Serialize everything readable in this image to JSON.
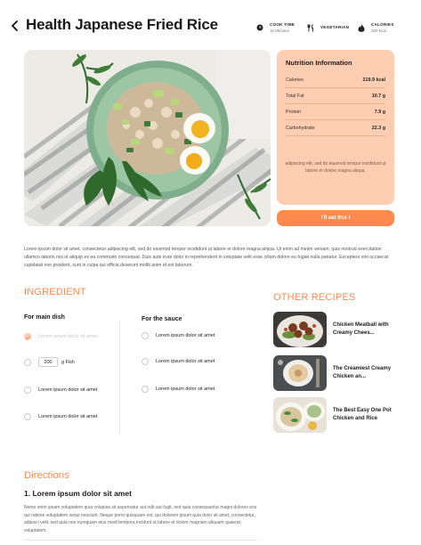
{
  "header": {
    "title": "Health Japanese Fried Rice",
    "meta": [
      {
        "label": "COOK TIME",
        "value": "15 Minutes",
        "icon": "clock-icon"
      },
      {
        "label": "VEGETARIAN",
        "value": "",
        "icon": "fork-knife-icon"
      },
      {
        "label": "CALORIES",
        "value": "200 kcal",
        "icon": "flame-icon"
      }
    ]
  },
  "nutrition": {
    "title": "Nutrition Information",
    "rows": [
      {
        "name": "Calories",
        "value": "219.9 kcal"
      },
      {
        "name": "Total Fat",
        "value": "10.7 g"
      },
      {
        "name": "Protein",
        "value": "7.9 g"
      },
      {
        "name": "Carbohydrate",
        "value": "22.3 g"
      }
    ],
    "note": "adipiscing elit, sed do eiusmod tempor incididunt ut labore et dolore magna aliqua.",
    "button": "I'll eat this !"
  },
  "intro": "Lorem ipsum dolor sit amet, consectetur adipiscing elit, sed do eiusmod tempor incididunt ut labore et dolore magna aliqua. Ut enim ad minim veniam, quis nostrud exercitation ullamco laboris nisi ut aliquip ex ea commodo consequat. Duis aute irure dolor in reprehenderit in voluptate velit esse cillum dolore eu fugiat nulla pariatur. Excepteur sint occaecat cupidatat non proident, sunt in culpa qui officia deserunt mollit anim id est laborum.",
  "ingredient": {
    "title": "INGREDIENT",
    "main_title": "For main dish",
    "main_items": [
      {
        "text": "Lorem ipsum dolor sit amet",
        "checked": true
      },
      {
        "qty": "200",
        "unit": "g Fish"
      },
      {
        "text": "Lorem ipsum dolor sit amet"
      },
      {
        "text": "Lorem ipsum dolor sit amet"
      }
    ],
    "sauce_title": "For the sauce",
    "sauce_items": [
      "Lorem ipsum dolor sit amet",
      "Lorem ipsum dolor sit amet",
      "Lorem ipsum dolor sit amet"
    ]
  },
  "other_recipes": {
    "title": "OTHER RECIPES",
    "items": [
      {
        "title": "Chicken Meatball with Creamy Chees..."
      },
      {
        "title": "The Creamiest Creamy Chicken an..."
      },
      {
        "title": "The Best Easy One Pot Chicken and Rice"
      }
    ]
  },
  "directions": {
    "title": "Directions",
    "step_title": "1. Lorem ipsum dolor sit amet",
    "step_text": "Nemo enim ipsam voluptatem quia voluptas sit aspernatur aut odit aut fugit, sed quia consequuntur magni dolores eos qui ratione voluptatem sequi nesciunt. Neque porro quisquam est, qui dolorem ipsum quia dolor sit amet, consectetur, adipisci velit, sed quia non numquam eius modi tempora incidunt ut labore et dolore magnam aliquam quaerat voluptatem."
  },
  "colors": {
    "accent": "#ff8a50",
    "panel": "#ffcdb2"
  }
}
